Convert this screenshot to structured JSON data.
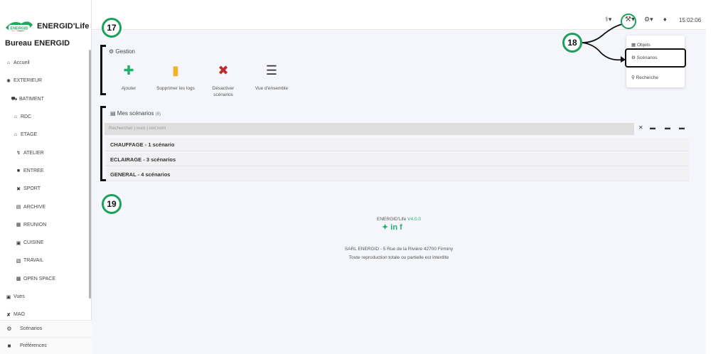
{
  "app": {
    "logo_badge": "ENERGID",
    "logo_text": "ENERGID'Life",
    "site_title": "Bureau ENERGID"
  },
  "sidebar": {
    "items": [
      {
        "label": "Accueil",
        "icon": "home-icon"
      },
      {
        "label": "EXTERIEUR",
        "icon": "sun-icon"
      },
      {
        "label": "BATIMENT",
        "icon": "truck-icon"
      },
      {
        "label": "RDC",
        "icon": "home-icon"
      },
      {
        "label": "ETAGE",
        "icon": "home-icon"
      },
      {
        "label": "ATELIER",
        "icon": "bolt-icon"
      },
      {
        "label": "ENTREE",
        "icon": "person-icon"
      },
      {
        "label": "SPORT",
        "icon": "sport-icon"
      },
      {
        "label": "ARCHIVE",
        "icon": "books-icon"
      },
      {
        "label": "REUNION",
        "icon": "meeting-icon"
      },
      {
        "label": "CUISINE",
        "icon": "kitchen-icon"
      },
      {
        "label": "TRAVAIL",
        "icon": "calendar-icon"
      },
      {
        "label": "OPEN SPACE",
        "icon": "group-icon"
      },
      {
        "label": "Vues",
        "icon": "image-icon"
      },
      {
        "label": "MAO",
        "icon": "tools-icon"
      }
    ],
    "bottom": [
      {
        "label": "Scénarios",
        "icon": "gear-icon"
      },
      {
        "label": "Préférences",
        "icon": "briefcase-icon"
      }
    ]
  },
  "topbar": {
    "time": "15:02:06",
    "icons": [
      "health-icon",
      "wrench-icon",
      "gear-icon",
      "bell-icon"
    ]
  },
  "dropdown": {
    "items": [
      "Objets",
      "Scénarios",
      "Recherche"
    ]
  },
  "gestion": {
    "title": "Gestion",
    "actions": [
      {
        "label": "Ajouter",
        "icon": "plus-circle-icon",
        "color": "#20b26b"
      },
      {
        "label": "Supprimer les logs",
        "icon": "trash-icon",
        "color": "#f0b429"
      },
      {
        "label": "Désactiver scénarios",
        "icon": "times-icon",
        "color": "#c0282d"
      },
      {
        "label": "Vue d'ensemble",
        "icon": "list-icon",
        "color": "#333333"
      }
    ]
  },
  "scenarios": {
    "title": "Mes scénarios",
    "count": "(8)",
    "search_placeholder": "Rechercher | nom | not:nom",
    "groups": [
      {
        "label": "CHAUFFAGE - 1 scénario"
      },
      {
        "label": "ECLAIRAGE - 3 scénarios"
      },
      {
        "label": "GENERAL - 4 scénarios"
      }
    ]
  },
  "footer": {
    "brand": "ENERGID'Life",
    "version": "V4.0.0",
    "address": "SARL ENERGID - 5 Rue de la Rivière 42700 Firminy",
    "rights": "Toute reproduction totale ou partielle est interdite"
  },
  "callouts": [
    "17",
    "18",
    "19"
  ],
  "colors": {
    "accent": "#20b26b",
    "callout_ring": "#1aa15a"
  }
}
